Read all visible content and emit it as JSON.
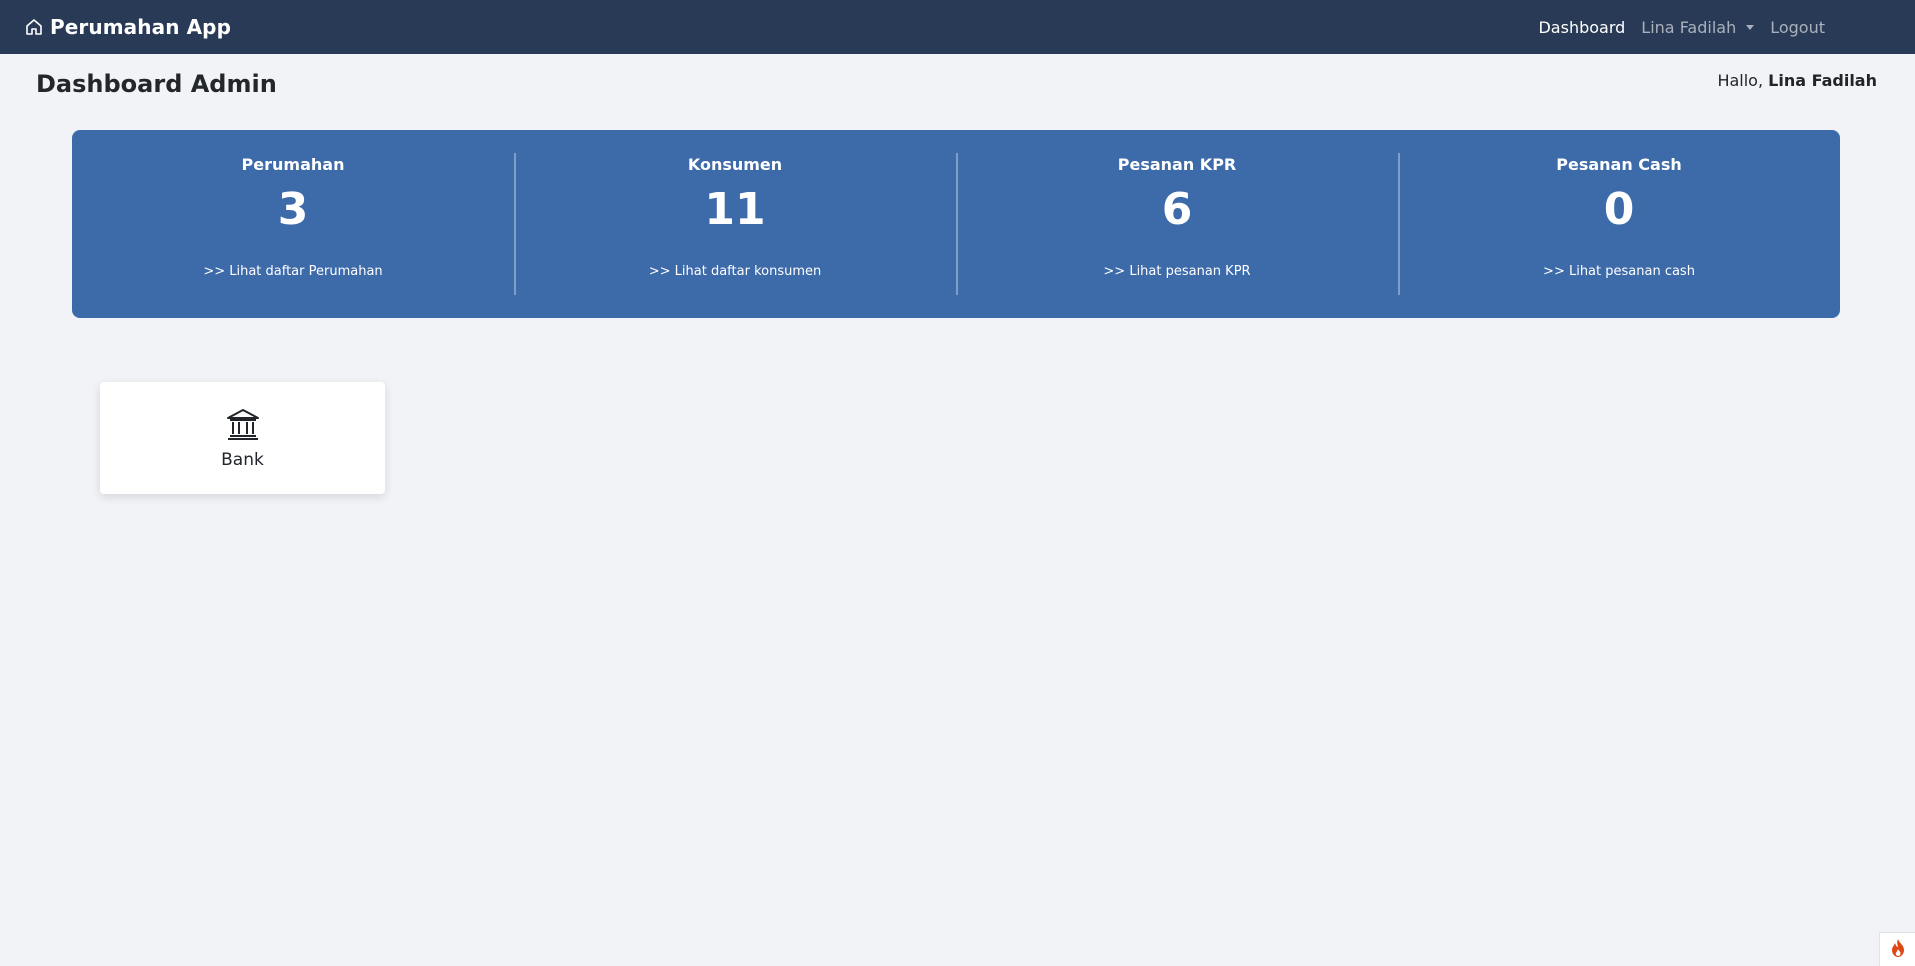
{
  "navbar": {
    "brand": "Perumahan App",
    "brand_icon": "home-icon",
    "links": {
      "dashboard": "Dashboard",
      "user": "Lina Fadilah",
      "logout": "Logout"
    }
  },
  "header": {
    "title": "Dashboard Admin",
    "greeting_prefix": "Hallo,",
    "greeting_name": "Lina Fadilah"
  },
  "stats": [
    {
      "label": "Perumahan",
      "value": "3",
      "link": ">> Lihat daftar Perumahan"
    },
    {
      "label": "Konsumen",
      "value": "11",
      "link": ">> Lihat daftar konsumen"
    },
    {
      "label": "Pesanan KPR",
      "value": "6",
      "link": ">> Lihat pesanan KPR"
    },
    {
      "label": "Pesanan Cash",
      "value": "0",
      "link": ">> Lihat pesanan cash"
    }
  ],
  "menu_cards": [
    {
      "label": "Bank",
      "icon": "bank-icon"
    }
  ],
  "corner_toolbar": {
    "icon": "flame-icon"
  },
  "colors": {
    "navbar_bg": "#283a56",
    "stats_bg": "#3d6aa9",
    "page_bg": "#f1f3f7",
    "flame": "#dd4814"
  }
}
